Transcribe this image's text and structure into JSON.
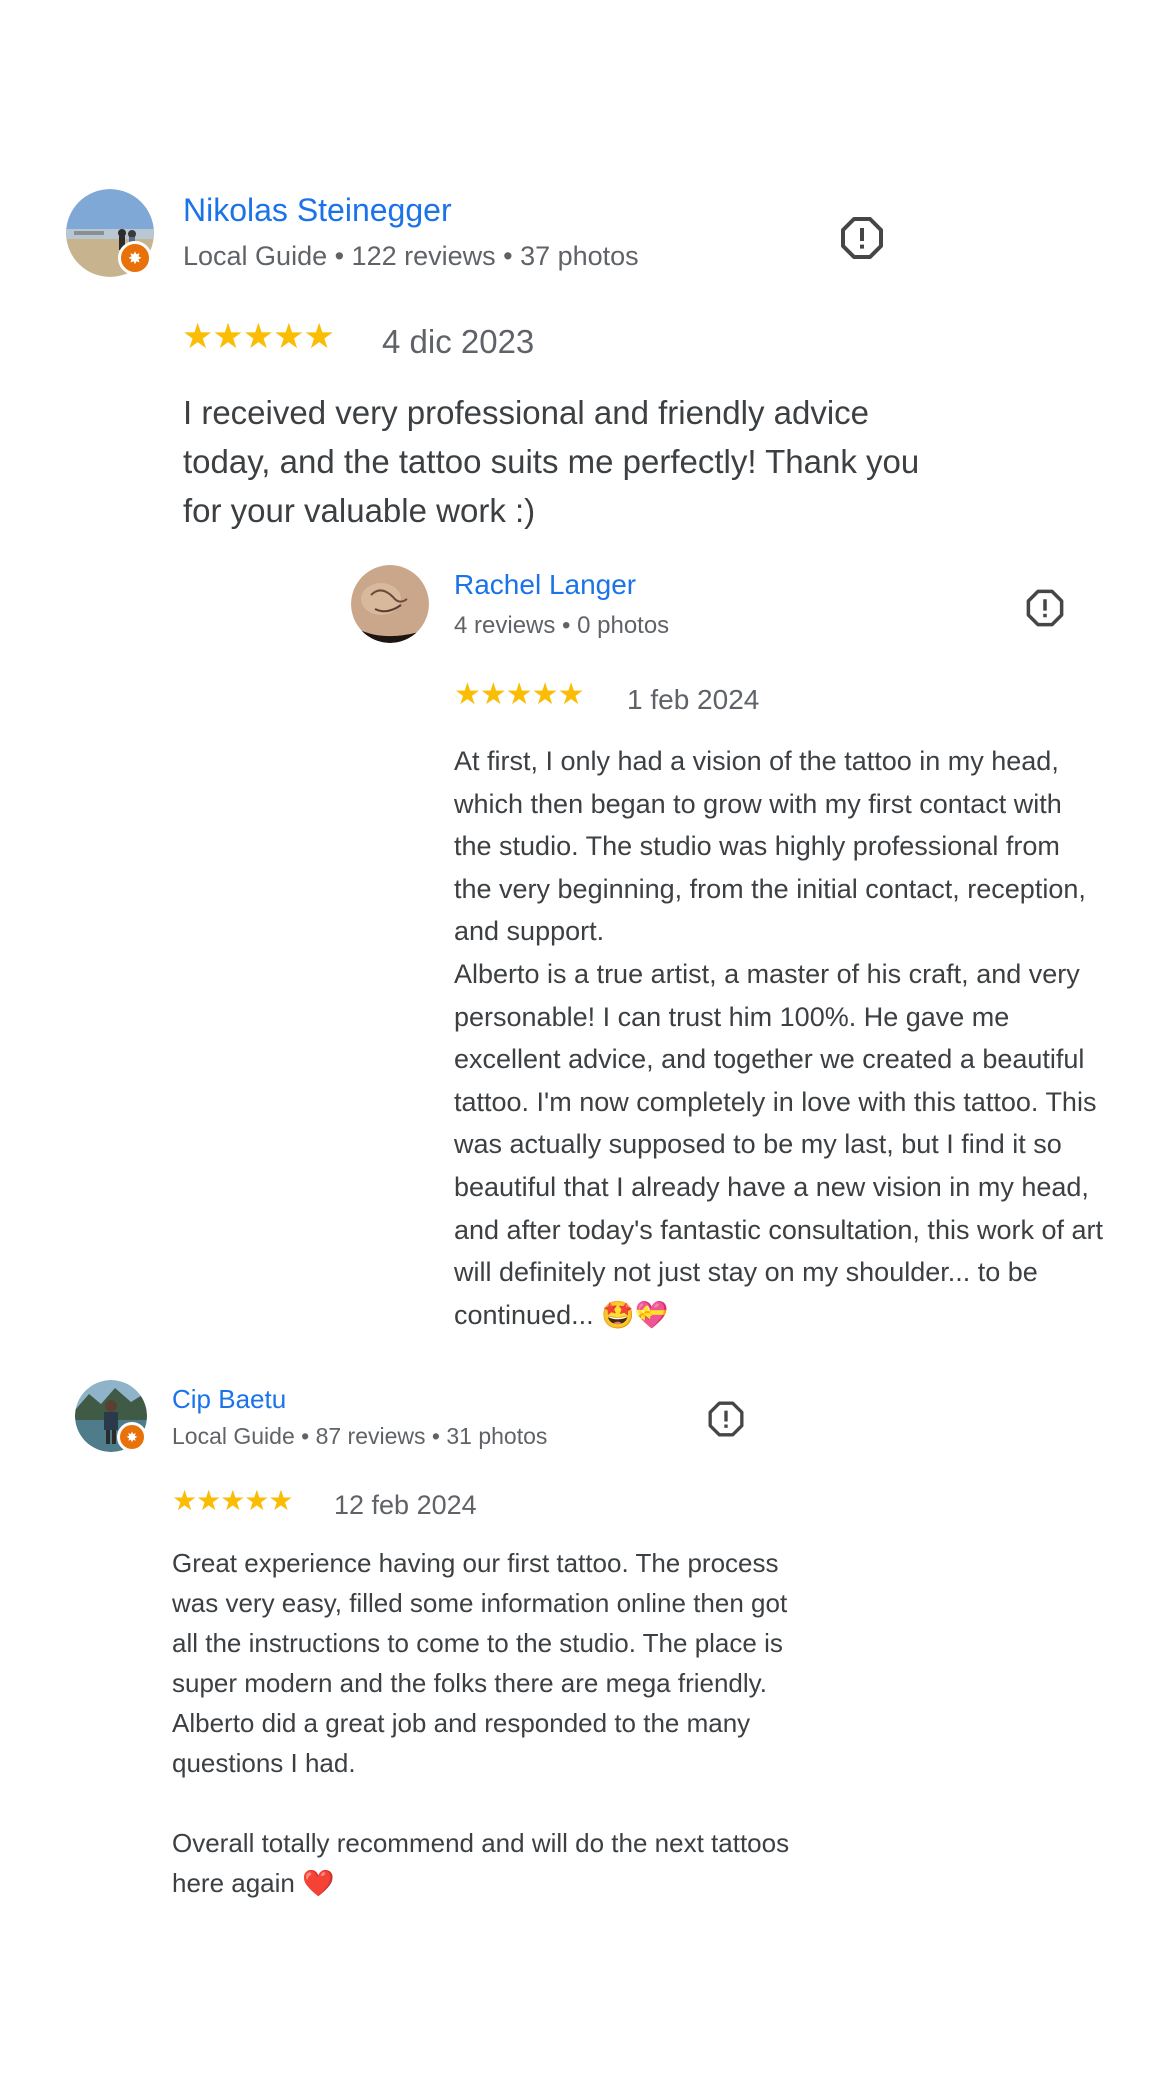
{
  "reviews": [
    {
      "name": "Nikolas Steinegger",
      "meta": "Local Guide • 122 reviews • 37 photos",
      "rating": 5,
      "stars": "★★★★★",
      "date": "4 dic 2023",
      "text": "I received very professional and friendly advice today, and the tattoo suits me perfectly! Thank you for your valuable work :)",
      "local_guide": true
    },
    {
      "name": "Rachel Langer",
      "meta": "4 reviews • 0 photos",
      "rating": 5,
      "stars": "★★★★★",
      "date": "1 feb 2024",
      "text": "At first, I only had a vision of the tattoo in my head, which then began to grow with my first contact with the studio. The studio was highly professional from the very beginning, from the initial contact, reception, and support.\nAlberto is a true artist, a master of his craft, and very personable! I can trust him 100%. He gave me excellent advice, and together we created a beautiful tattoo. I'm now completely in love with this tattoo. This was actually supposed to be my last, but I find it so beautiful that I already have a new vision in my head, and after today's fantastic consultation, this work of art will definitely not just stay on my shoulder... to be continued... 🤩💝",
      "local_guide": false
    },
    {
      "name": "Cip Baetu",
      "meta": "Local Guide • 87 reviews • 31 photos",
      "rating": 5,
      "stars": "★★★★★",
      "date": "12 feb 2024",
      "text": "Great experience having our first tattoo. The process was very easy, filled some information online then got all the instructions to come to the studio. The place is super modern and the folks there are mega friendly. Alberto did a great job and responded to the many questions I had.\n\nOverall totally recommend and will do the next tattoos here again ❤️",
      "local_guide": true
    }
  ],
  "colors": {
    "name": "#1a73e8",
    "star": "#fbbc04",
    "meta": "#5f6368",
    "text": "#3c4043",
    "local_guide_badge": "#e8710a"
  },
  "icons": {
    "report": "report-flag-icon",
    "local_guide": "local-guide-star-icon",
    "star": "star-icon"
  }
}
